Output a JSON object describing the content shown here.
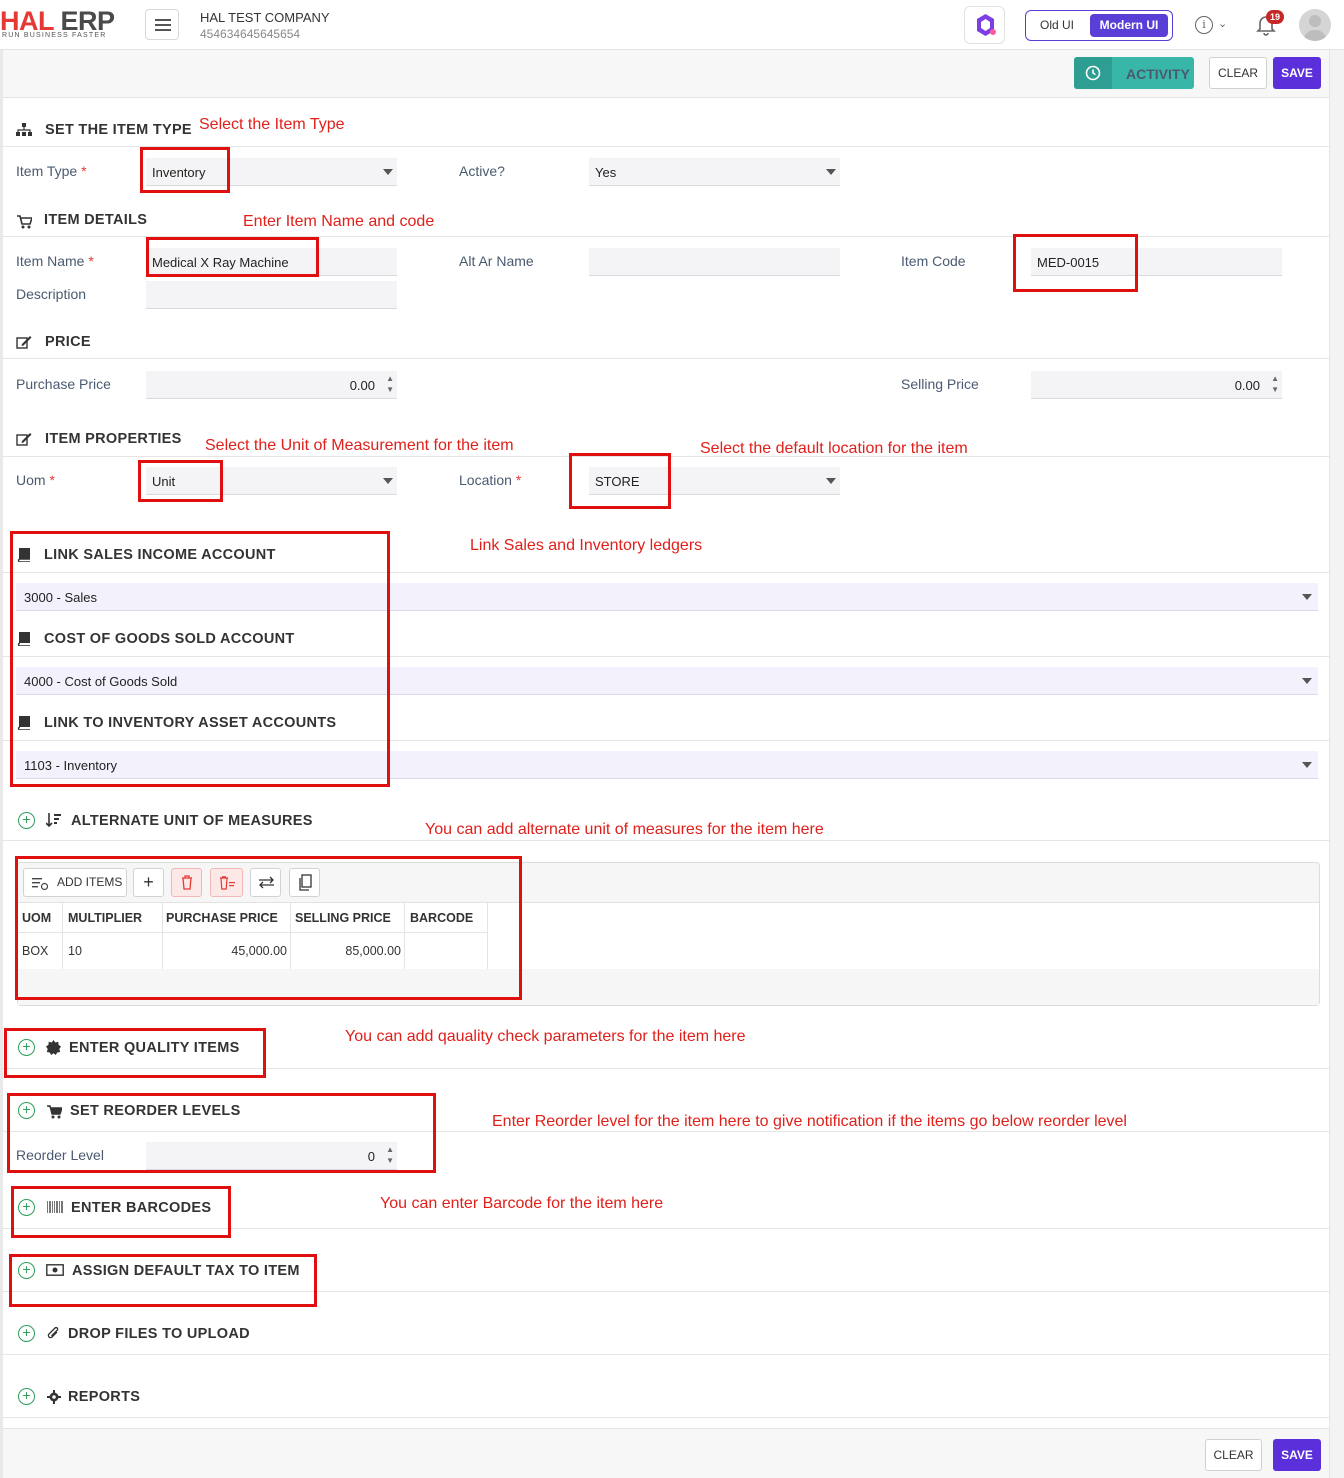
{
  "header": {
    "logo_main_a": "HAL",
    "logo_main_b": "ERP",
    "logo_sub": "RUN BUSINESS FASTER",
    "company_name": "HAL TEST COMPANY",
    "company_id": "454634645645654",
    "ui_old_label": "Old UI",
    "ui_modern_label": "Modern UI",
    "notification_count": "19",
    "brand_color": "#5b3ed6"
  },
  "actions": {
    "activity_label": "ACTIVITY",
    "clear_label": "CLEAR",
    "save_label": "SAVE"
  },
  "item_type_section": {
    "title": "SET THE ITEM TYPE",
    "item_type_label": "Item Type",
    "item_type_value": "Inventory",
    "active_label": "Active?",
    "active_value": "Yes"
  },
  "item_details": {
    "title": "ITEM DETAILS",
    "item_name_label": "Item Name",
    "item_name_value": "Medical X Ray Machine",
    "alt_name_label": "Alt Ar Name",
    "alt_name_value": "",
    "item_code_label": "Item Code",
    "item_code_value": "MED-0015",
    "description_label": "Description",
    "description_value": ""
  },
  "price": {
    "title": "PRICE",
    "purchase_label": "Purchase Price",
    "purchase_value": "0.00",
    "selling_label": "Selling Price",
    "selling_value": "0.00"
  },
  "properties": {
    "title": "ITEM PROPERTIES",
    "uom_label": "Uom",
    "uom_value": "Unit",
    "location_label": "Location",
    "location_value": "STORE"
  },
  "accounts": {
    "sales_title": "LINK SALES INCOME ACCOUNT",
    "sales_value": "3000 - Sales",
    "cogs_title": "COST OF GOODS SOLD ACCOUNT",
    "cogs_value": "4000 - Cost of Goods Sold",
    "inventory_title": "LINK TO INVENTORY ASSET ACCOUNTS",
    "inventory_value": "1103 - Inventory"
  },
  "alt_uom": {
    "title": "ALTERNATE UNIT OF MEASURES",
    "add_items_label": "ADD ITEMS",
    "columns": [
      "UOM",
      "MULTIPLIER",
      "PURCHASE PRICE",
      "SELLING PRICE",
      "BARCODE"
    ],
    "rows": [
      {
        "uom": "BOX",
        "multiplier": "10",
        "purchase_price": "45,000.00",
        "selling_price": "85,000.00",
        "barcode": ""
      }
    ]
  },
  "collapsibles": {
    "quality": "ENTER QUALITY ITEMS",
    "reorder": "SET REORDER LEVELS",
    "reorder_label": "Reorder Level",
    "reorder_value": "0",
    "barcodes": "ENTER BARCODES",
    "tax": "ASSIGN DEFAULT TAX TO ITEM",
    "files": "DROP FILES TO UPLOAD",
    "reports": "REPORTS"
  },
  "annotations": {
    "item_type": "Select the Item Type",
    "item_name": "Enter Item Name and code",
    "uom": "Select the Unit of Measurement for the item",
    "location": "Select the default location for the item",
    "ledgers": "Link Sales and Inventory ledgers",
    "alt_uom": "You can add alternate unit of measures for the item here",
    "quality": "You can add qauality check parameters for the item here",
    "reorder": "Enter Reorder level for the item here to give notification if the items go below reorder level",
    "barcode": "You can enter Barcode for the item here",
    "annotation_color": "#e0201b"
  }
}
